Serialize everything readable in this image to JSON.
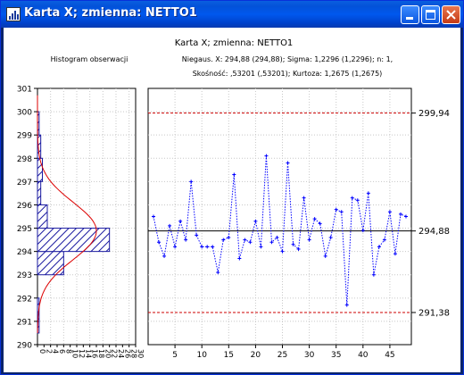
{
  "window": {
    "title": "Karta X; zmienna:  NETTO1",
    "buttons": {
      "minimize": "minimize-icon",
      "maximize": "maximize-icon",
      "close": "close-icon"
    }
  },
  "header": {
    "title": "Karta X; zmienna:  NETTO1",
    "hist_title": "Histogram obserwacji",
    "stats_line1": "Niegaus. X: 294,88 (294,88); Sigma: 1,2296 (1,2296); n: 1,",
    "stats_line2": "Skośność: ,53201 (,53201); Kurtoza: 1,2675 (1,2675)"
  },
  "chart_data": {
    "type": "line",
    "y_axis": {
      "min": 290,
      "max": 301,
      "ticks": [
        "301",
        "300",
        "299",
        "298",
        "297",
        "296",
        "295",
        "294",
        "293",
        "292",
        "291",
        "290"
      ]
    },
    "x_axis": {
      "min": 0,
      "max": 49,
      "ticks": [
        "5",
        "10",
        "15",
        "20",
        "25",
        "30",
        "35",
        "40",
        "45"
      ]
    },
    "histogram": {
      "x_ticks": [
        "0",
        "2",
        "4",
        "6",
        "8",
        "10",
        "12",
        "14",
        "16",
        "18",
        "20",
        "22",
        "24",
        "26",
        "28",
        "30"
      ],
      "x_max": 30,
      "bins": [
        {
          "from": 290.5,
          "to": 291,
          "count": 0.5
        },
        {
          "from": 291,
          "to": 292,
          "count": 0.5
        },
        {
          "from": 293,
          "to": 294,
          "count": 8
        },
        {
          "from": 294,
          "to": 295,
          "count": 22
        },
        {
          "from": 295,
          "to": 296,
          "count": 3
        },
        {
          "from": 296,
          "to": 297,
          "count": 1
        },
        {
          "from": 297,
          "to": 298,
          "count": 1.5
        },
        {
          "from": 298,
          "to": 299,
          "count": 1
        },
        {
          "from": 299,
          "to": 300,
          "count": 0.5
        }
      ],
      "normal_curve": {
        "mean": 294.88,
        "sigma": 1.2296,
        "peak": 18
      }
    },
    "limits": {
      "ucl": "299,94",
      "center": "294,88",
      "lcl": "291,38",
      "ucl_value": 299.94,
      "center_value": 294.88,
      "lcl_value": 291.38
    },
    "series": [
      {
        "x": [
          1,
          2,
          3,
          4,
          5,
          6,
          7,
          8,
          9,
          10,
          11,
          12,
          13,
          14,
          15,
          16,
          17,
          18,
          19,
          20,
          21,
          22,
          23,
          24,
          25,
          26,
          27,
          28,
          29,
          30,
          31,
          32,
          33,
          34,
          35,
          36,
          37,
          38,
          39,
          40,
          41,
          42,
          43,
          44,
          45,
          46,
          47,
          48
        ],
        "values": [
          295.5,
          294.4,
          293.8,
          295.1,
          294.2,
          295.3,
          294.5,
          297,
          294.7,
          294.2,
          294.2,
          294.2,
          293.1,
          294.5,
          294.6,
          297.3,
          293.7,
          294.5,
          294.4,
          295.3,
          294.2,
          298.1,
          294.4,
          294.6,
          294.0,
          297.8,
          294.3,
          294.1,
          296.3,
          294.5,
          295.4,
          295.2,
          293.8,
          294.6,
          295.8,
          295.7,
          291.7,
          296.3,
          296.2,
          294.9,
          296.5,
          293.0,
          294.2,
          294.5,
          295.7,
          293.9,
          295.6,
          295.5
        ]
      }
    ]
  },
  "colors": {
    "series": "#0000ff",
    "limit": "#cc0000",
    "normal_curve": "#dd0000",
    "bar_fill": "#1a1aa0",
    "center_line": "#000000"
  }
}
